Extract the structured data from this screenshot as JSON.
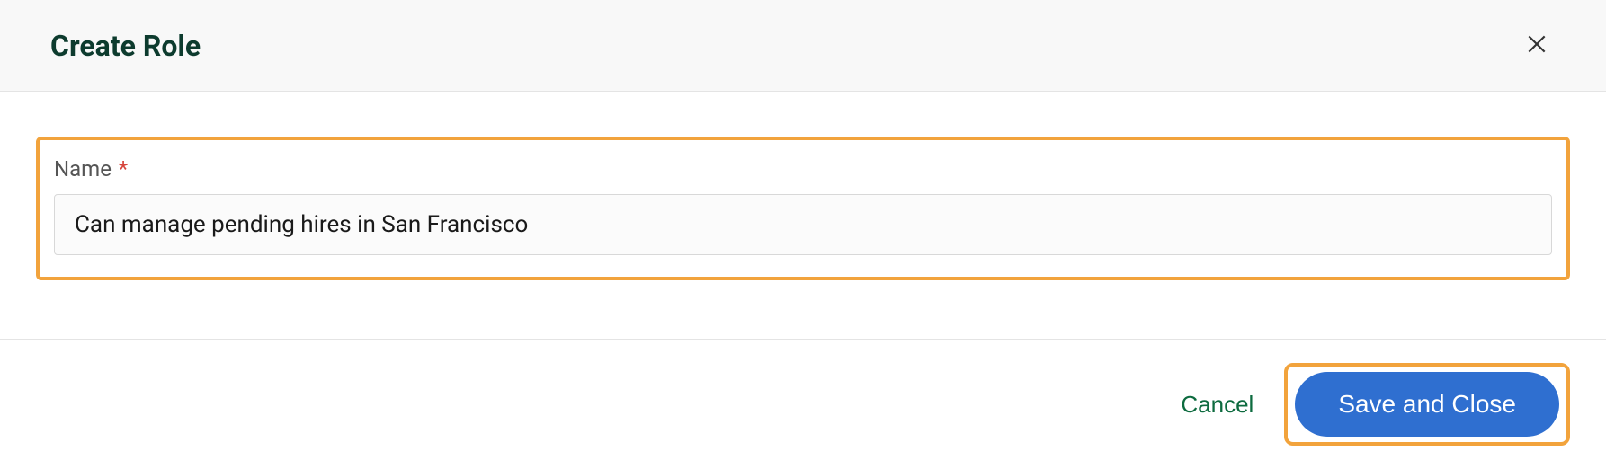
{
  "header": {
    "title": "Create Role"
  },
  "form": {
    "name_label": "Name",
    "required_mark": "*",
    "name_value": "Can manage pending hires in San Francisco"
  },
  "footer": {
    "cancel_label": "Cancel",
    "save_label": "Save and Close"
  }
}
